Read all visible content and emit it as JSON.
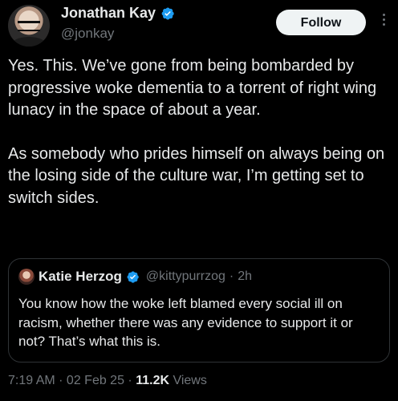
{
  "author": {
    "display_name": "Jonathan Kay",
    "handle": "@jonkay",
    "verified": true,
    "avatar_icon": "profile-photo"
  },
  "follow_button": {
    "label": "Follow"
  },
  "more_button": {
    "icon": "more-vertical-icon"
  },
  "tweet": {
    "paragraphs": [
      "Yes. This. We’ve gone from being bombarded by progressive woke dementia to a torrent of right wing lunacy in the space of about a year.",
      "As somebody who prides himself on always being on the losing side of the culture war, I’m getting set to switch sides."
    ]
  },
  "quoted_tweet": {
    "display_name": "Katie Herzog",
    "handle": "@kittypurrzog",
    "separator": "·",
    "time": "2h",
    "verified": true,
    "text": "You know how the woke left blamed every social ill on racism, whether there was any evidence to support it or not? That’s what this is."
  },
  "meta": {
    "time": "7:19 AM",
    "separator1": " · ",
    "date": "02 Feb 25",
    "separator2": " · ",
    "views_count": "11.2K",
    "views_label": " Views"
  },
  "colors": {
    "background": "#000000",
    "text": "#e7e9ea",
    "secondary": "#71767b",
    "verified": "#1d9bf0",
    "border": "#2f3336",
    "follow_bg": "#eff3f4"
  }
}
